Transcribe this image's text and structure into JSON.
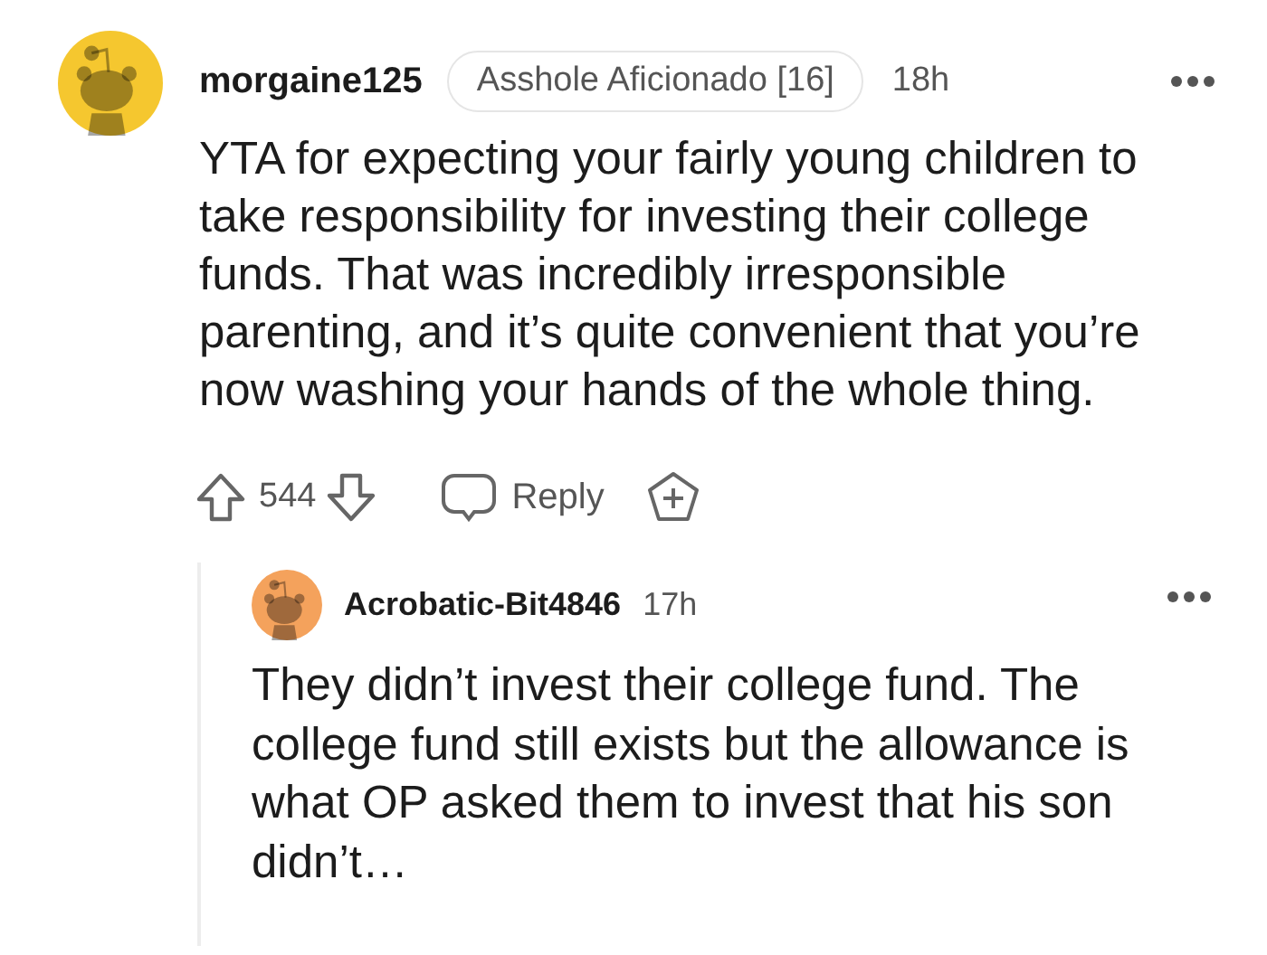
{
  "comment": {
    "author": "morgaine125",
    "flair": "Asshole Aficionado [16]",
    "time": "18h",
    "body": "YTA for expecting your fairly young children to take responsibility for investing their college funds. That was incredibly irresponsible parenting, and it’s quite convenient that you’re now washing your hands of the whole thing.",
    "score": "544",
    "reply_label": "Reply",
    "replies": [
      {
        "author": "Acrobatic-Bit4846",
        "time": "17h",
        "body": "They didn’t invest their college fund. The college fund still exists but the allowance is what OP asked them to invest that his son didn’t…"
      }
    ]
  }
}
